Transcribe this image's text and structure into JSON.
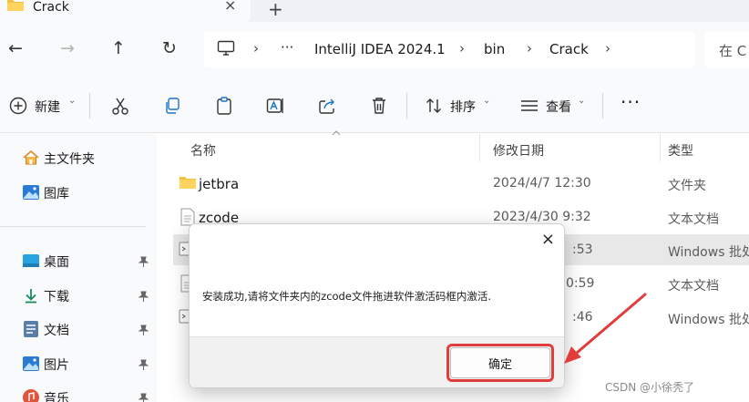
{
  "tab": {
    "title": "Crack",
    "close": "×",
    "new": "+"
  },
  "nav": {
    "back": "←",
    "forward": "→",
    "up": "↑",
    "refresh": "↻"
  },
  "breadcrumb": {
    "ellipsis": "···",
    "sep": "›",
    "items": [
      "IntelliJ IDEA 2024.1",
      "bin",
      "Crack"
    ]
  },
  "search": {
    "placeholder": "在 C"
  },
  "toolbar": {
    "new": "新建",
    "sort": "排序",
    "view": "查看",
    "more": "···",
    "caret": "⌄"
  },
  "sidebar": {
    "items": [
      {
        "label": "主文件夹"
      },
      {
        "label": "图库"
      },
      {
        "label": "桌面",
        "pin": "📌"
      },
      {
        "label": "下载",
        "pin": "📌"
      },
      {
        "label": "文档",
        "pin": "📌"
      },
      {
        "label": "图片",
        "pin": "📌"
      },
      {
        "label": "音乐",
        "pin": "📌"
      }
    ]
  },
  "columns": {
    "name": "名称",
    "modified": "修改日期",
    "type": "类型"
  },
  "files": [
    {
      "name": "jetbra",
      "date": "2024/4/7 12:30",
      "type": "文件夹"
    },
    {
      "name": "zcode",
      "date": "2023/4/30 9:32",
      "type": "文本文档"
    },
    {
      "name": "",
      "date": ":53",
      "type": "Windows 批处"
    },
    {
      "name": "",
      "date": "0:59",
      "type": "文本文档"
    },
    {
      "name": "",
      "date": ":46",
      "type": "Windows 批处"
    }
  ],
  "dialog": {
    "message": "安装成功,请将文件夹内的zcode文件拖进软件激活码框内激活.",
    "ok_label": "确定",
    "close": "×"
  },
  "watermark": "CSDN @小徐秃了",
  "colors": {
    "highlight": "#e23d3d",
    "folder": "#f5c042"
  }
}
